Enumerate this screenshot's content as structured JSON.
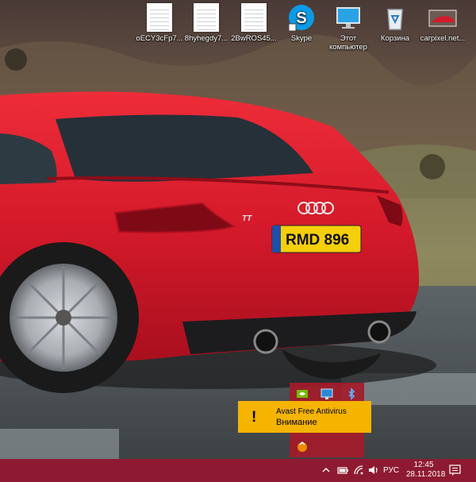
{
  "desktop": {
    "icons": [
      {
        "label": "oECY3cFp7...",
        "icon": "text-document-icon"
      },
      {
        "label": "8hyhegdy7...",
        "icon": "text-document-icon"
      },
      {
        "label": "2BwROS45...",
        "icon": "text-document-icon"
      },
      {
        "label": "Skype",
        "icon": "skype-icon"
      },
      {
        "label": "Этот компьютер",
        "icon": "computer-icon"
      },
      {
        "label": "Корзина",
        "icon": "recycle-bin-icon"
      },
      {
        "label": "carpixel.net...",
        "icon": "image-file-icon"
      }
    ],
    "wallpaper": {
      "plate_text": "RMD 896",
      "model_badge": "TT"
    }
  },
  "toast": {
    "title": "Avast Free Antivirus",
    "message": "Внимание",
    "icon": "warning-exclamation-icon",
    "background": "#f4b400"
  },
  "tray_overflow": {
    "icons": [
      "nvidia-icon",
      "display-settings-icon",
      "bluetooth-icon",
      "avast-icon"
    ],
    "background": "#a41b2a"
  },
  "taskbar": {
    "background": "#8e1a31",
    "tray_icons": [
      "chevron-up-icon",
      "battery-icon",
      "wifi-icon",
      "volume-icon"
    ],
    "language": "РУС",
    "time": "12:45",
    "date": "28.11.2018",
    "notification_icon": "action-center-icon"
  }
}
